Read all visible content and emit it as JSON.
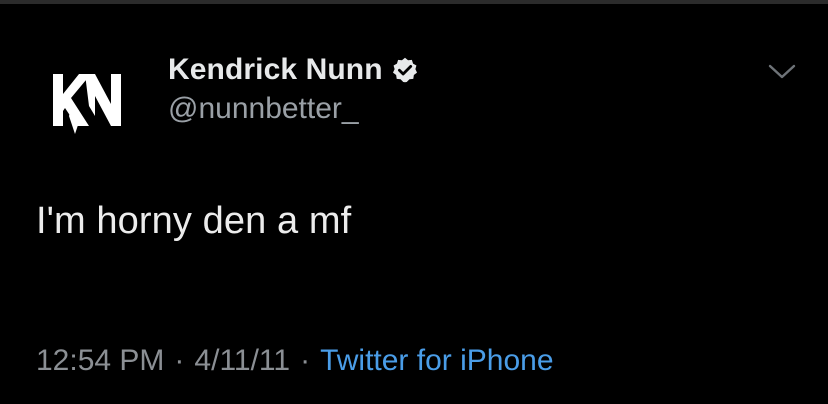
{
  "tweet": {
    "author": {
      "display_name": "Kendrick Nunn",
      "handle": "@nunnbetter_",
      "verified": true,
      "avatar_icon": "kn-logo-icon"
    },
    "text": "I'm horny den a mf",
    "time": "12:54 PM",
    "separator": "·",
    "date": "4/11/11",
    "source": "Twitter for iPhone",
    "menu_icon": "chevron-down-icon"
  },
  "colors": {
    "background": "#000000",
    "name": "#e7e9ea",
    "secondary": "#9aa0a6",
    "source_link": "#4a9de8",
    "verified_badge": "#e7e9ea"
  }
}
